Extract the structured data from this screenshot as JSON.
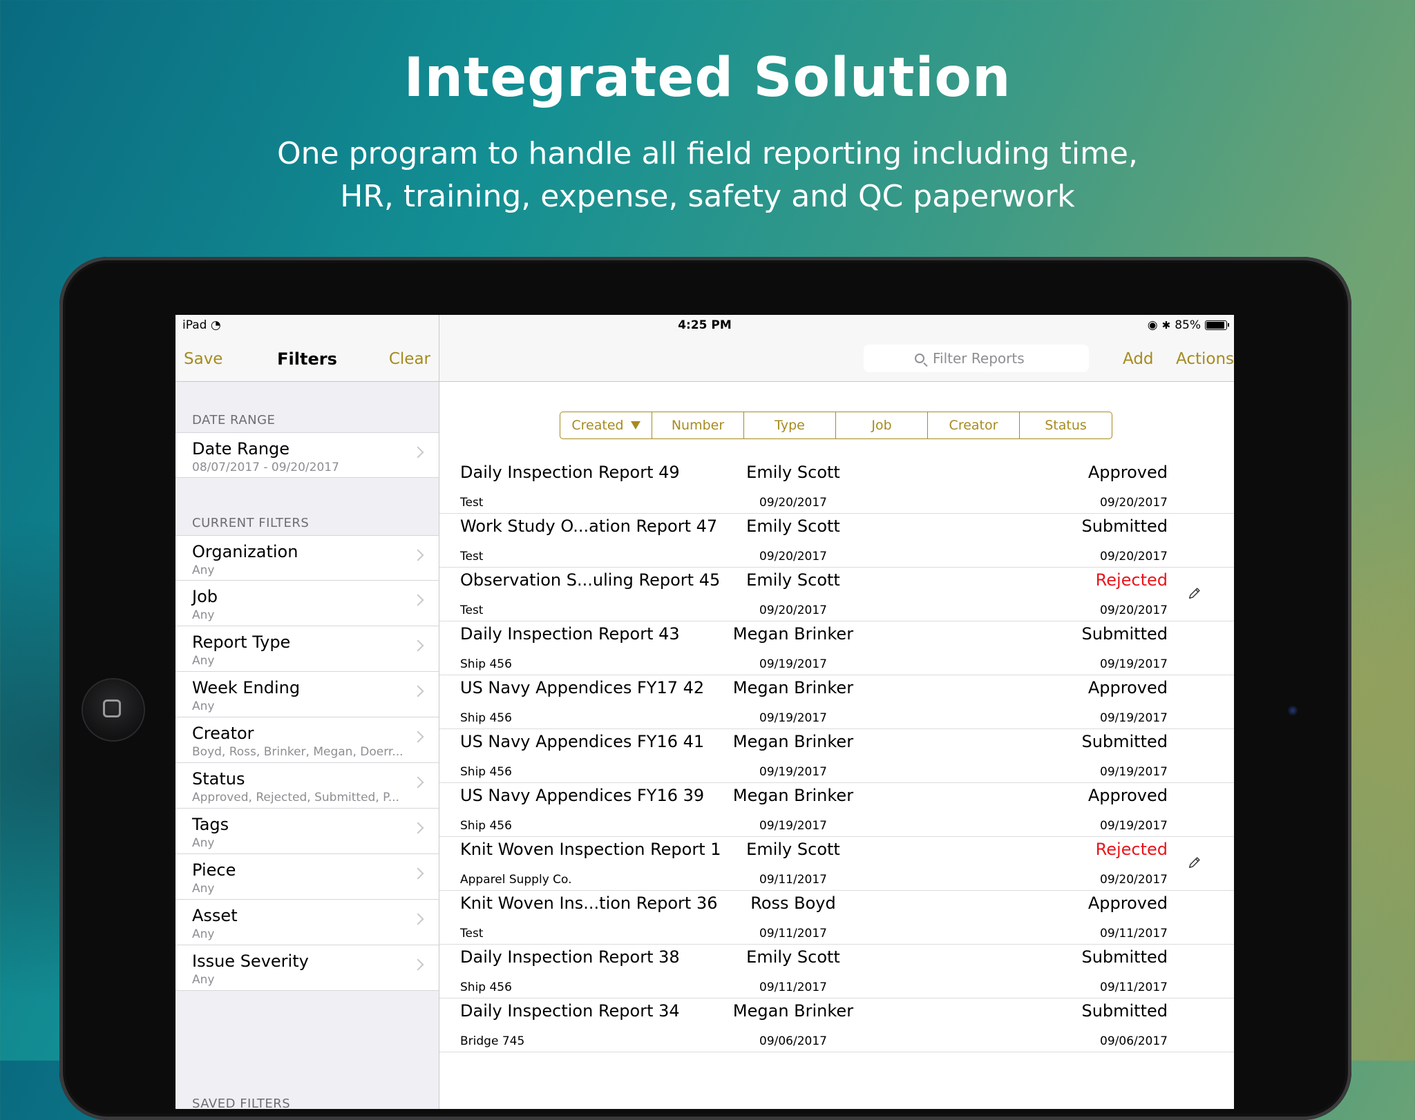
{
  "promo": {
    "headline": "Integrated Solution",
    "subline_1": "One program to handle all field reporting including time,",
    "subline_2": "HR, training, expense, safety and QC paperwork"
  },
  "status_bar": {
    "device": "iPad",
    "time": "4:25 PM",
    "battery": "85%"
  },
  "sidebar": {
    "save": "Save",
    "title": "Filters",
    "clear": "Clear",
    "date_section": "DATE RANGE",
    "date_range": {
      "title": "Date Range",
      "value": "08/07/2017 - 09/20/2017"
    },
    "filters_section": "CURRENT FILTERS",
    "filters": [
      {
        "title": "Organization",
        "value": "Any"
      },
      {
        "title": "Job",
        "value": "Any"
      },
      {
        "title": "Report Type",
        "value": "Any"
      },
      {
        "title": "Week Ending",
        "value": "Any"
      },
      {
        "title": "Creator",
        "value": "Boyd, Ross, Brinker, Megan, Doerr..."
      },
      {
        "title": "Status",
        "value": "Approved, Rejected, Submitted, P..."
      },
      {
        "title": "Tags",
        "value": "Any"
      },
      {
        "title": "Piece",
        "value": "Any"
      },
      {
        "title": "Asset",
        "value": "Any"
      },
      {
        "title": "Issue Severity",
        "value": "Any"
      }
    ],
    "saved_section": "SAVED FILTERS"
  },
  "main": {
    "search_placeholder": "Filter Reports",
    "add": "Add",
    "actions": "Actions",
    "sort_options": [
      "Created",
      "Number",
      "Type",
      "Job",
      "Creator",
      "Status"
    ],
    "reports": [
      {
        "name": "Daily Inspection Report 49",
        "creator": "Emily Scott",
        "status": "Approved",
        "job": "Test",
        "created": "09/20/2017",
        "updated": "09/20/2017",
        "editable": false
      },
      {
        "name": "Work Study O...ation Report 47",
        "creator": "Emily Scott",
        "status": "Submitted",
        "job": "Test",
        "created": "09/20/2017",
        "updated": "09/20/2017",
        "editable": false
      },
      {
        "name": "Observation S...uling Report 45",
        "creator": "Emily Scott",
        "status": "Rejected",
        "job": "Test",
        "created": "09/20/2017",
        "updated": "09/20/2017",
        "editable": true
      },
      {
        "name": "Daily Inspection Report 43",
        "creator": "Megan Brinker",
        "status": "Submitted",
        "job": "Ship 456",
        "created": "09/19/2017",
        "updated": "09/19/2017",
        "editable": false
      },
      {
        "name": "US Navy Appendices FY17 42",
        "creator": "Megan Brinker",
        "status": "Approved",
        "job": "Ship 456",
        "created": "09/19/2017",
        "updated": "09/19/2017",
        "editable": false
      },
      {
        "name": "US Navy Appendices FY16 41",
        "creator": "Megan Brinker",
        "status": "Submitted",
        "job": "Ship 456",
        "created": "09/19/2017",
        "updated": "09/19/2017",
        "editable": false
      },
      {
        "name": "US Navy Appendices FY16 39",
        "creator": "Megan Brinker",
        "status": "Approved",
        "job": "Ship 456",
        "created": "09/19/2017",
        "updated": "09/19/2017",
        "editable": false
      },
      {
        "name": "Knit Woven Inspection Report 1",
        "creator": "Emily Scott",
        "status": "Rejected",
        "job": "Apparel Supply Co.",
        "created": "09/11/2017",
        "updated": "09/20/2017",
        "editable": true
      },
      {
        "name": "Knit Woven Ins...tion Report 36",
        "creator": "Ross Boyd",
        "status": "Approved",
        "job": "Test",
        "created": "09/11/2017",
        "updated": "09/11/2017",
        "editable": false
      },
      {
        "name": "Daily Inspection Report 38",
        "creator": "Emily Scott",
        "status": "Submitted",
        "job": "Ship 456",
        "created": "09/11/2017",
        "updated": "09/11/2017",
        "editable": false
      },
      {
        "name": "Daily Inspection Report 34",
        "creator": "Megan Brinker",
        "status": "Submitted",
        "job": "Bridge 745",
        "created": "09/06/2017",
        "updated": "09/06/2017",
        "editable": false
      }
    ]
  },
  "colors": {
    "accent": "#a68b1f",
    "rejected": "#e8151b"
  }
}
